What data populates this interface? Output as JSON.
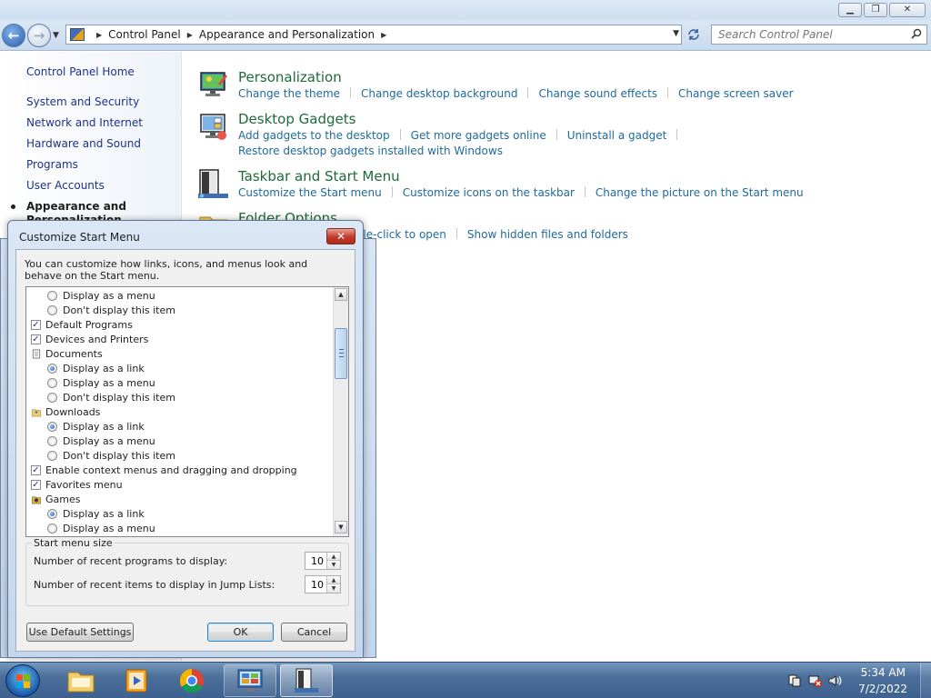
{
  "address": {
    "crumbs": [
      "Control Panel",
      "Appearance and Personalization"
    ],
    "search_placeholder": "Search Control Panel"
  },
  "left_nav": {
    "home": "Control Panel Home",
    "items": [
      "System and Security",
      "Network and Internet",
      "Hardware and Sound",
      "Programs",
      "User Accounts"
    ],
    "active": "Appearance and Personalization"
  },
  "categories": [
    {
      "title": "Personalization",
      "links": [
        "Change the theme",
        "Change desktop background",
        "Change sound effects",
        "Change screen saver"
      ]
    },
    {
      "title": "Desktop Gadgets",
      "links": [
        "Add gadgets to the desktop",
        "Get more gadgets online",
        "Uninstall a gadget"
      ],
      "links_line2": [
        "Restore desktop gadgets installed with Windows"
      ]
    },
    {
      "title": "Taskbar and Start Menu",
      "links": [
        "Customize the Start menu",
        "Customize icons on the taskbar",
        "Change the picture on the Start menu"
      ]
    },
    {
      "title": "Folder Options",
      "links": [
        "Specify single- or double-click to open",
        "Show hidden files and folders"
      ]
    }
  ],
  "dialog": {
    "title": "Customize Start Menu",
    "description": "You can customize how links, icons, and menus look and behave on the Start menu.",
    "options": [
      {
        "kind": "radio",
        "label": "Display as a menu",
        "checked": false
      },
      {
        "kind": "radio",
        "label": "Don't display this item",
        "checked": false
      },
      {
        "kind": "check",
        "label": "Default Programs",
        "checked": true
      },
      {
        "kind": "check",
        "label": "Devices and Printers",
        "checked": true
      },
      {
        "kind": "group",
        "label": "Documents",
        "icon": "document-icon"
      },
      {
        "kind": "radio",
        "label": "Display as a link",
        "checked": true
      },
      {
        "kind": "radio",
        "label": "Display as a menu",
        "checked": false
      },
      {
        "kind": "radio",
        "label": "Don't display this item",
        "checked": false
      },
      {
        "kind": "group",
        "label": "Downloads",
        "icon": "downloads-folder-icon"
      },
      {
        "kind": "radio",
        "label": "Display as a link",
        "checked": true
      },
      {
        "kind": "radio",
        "label": "Display as a menu",
        "checked": false
      },
      {
        "kind": "radio",
        "label": "Don't display this item",
        "checked": false
      },
      {
        "kind": "check",
        "label": "Enable context menus and dragging and dropping",
        "checked": true
      },
      {
        "kind": "check",
        "label": "Favorites menu",
        "checked": true
      },
      {
        "kind": "group",
        "label": "Games",
        "icon": "games-icon"
      },
      {
        "kind": "radio",
        "label": "Display as a link",
        "checked": true
      },
      {
        "kind": "radio",
        "label": "Display as a menu",
        "checked": false
      }
    ],
    "size_group": {
      "legend": "Start menu size",
      "recent_programs_label": "Number of recent programs to display:",
      "recent_programs_value": "10",
      "jump_list_label": "Number of recent items to display in Jump Lists:",
      "jump_list_value": "10"
    },
    "buttons": {
      "defaults": "Use Default Settings",
      "ok": "OK",
      "cancel": "Cancel"
    }
  },
  "taskbar": {
    "items": [
      "file-explorer-icon",
      "media-player-icon",
      "chrome-icon",
      "control-panel-icon",
      "taskbar-start-menu-icon"
    ],
    "clock_time": "5:34 AM",
    "clock_date": "7/2/2022"
  },
  "colors": {
    "link": "#1f6a9c",
    "category_title": "#1e6a3a",
    "nav_link": "#1e3287"
  }
}
